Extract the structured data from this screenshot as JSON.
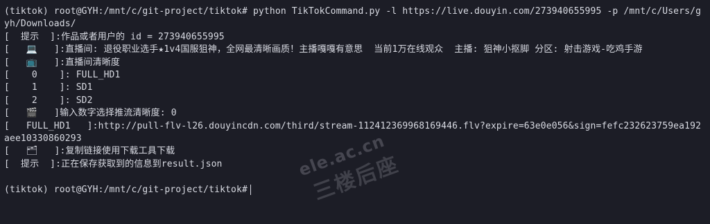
{
  "terminal": {
    "lines": [
      "(tiktok) root@GYH:/mnt/c/git-project/tiktok# python TikTokCommand.py -l https://live.douyin.com/273940655995 -p /mnt/c/Users/gyh/Downloads/",
      "[  提示  ]:作品或者用户的 id = 273940655995",
      "[   💻   ]:直播间: 退役职业选手★1v4国服狙神，全网最清晰画质！主播嘎嘎有意思  当前1万在线观众  主播: 狙神小抠脚 分区: 射击游戏-吃鸡手游",
      "[   📺   ]:直播间清晰度",
      "[    0    ]: FULL_HD1",
      "[    1    ]: SD1",
      "[    2    ]: SD2",
      "[   🎬   ]输入数字选择推流清晰度: 0",
      "[   FULL_HD1   ]:http://pull-flv-l26.douyincdn.com/third/stream-112412369968169446.flv?expire=63e0e056&sign=fefc232623759ea192aee10330860293",
      "[   🗂   ]:复制链接使用下载工具下载",
      "[  提示  ]:正在保存获取到的信息到result.json",
      ""
    ],
    "prompt": "(tiktok) root@GYH:/mnt/c/git-project/tiktok#"
  },
  "watermark": {
    "domain": "ele.ac.cn",
    "title": "三楼后座"
  }
}
